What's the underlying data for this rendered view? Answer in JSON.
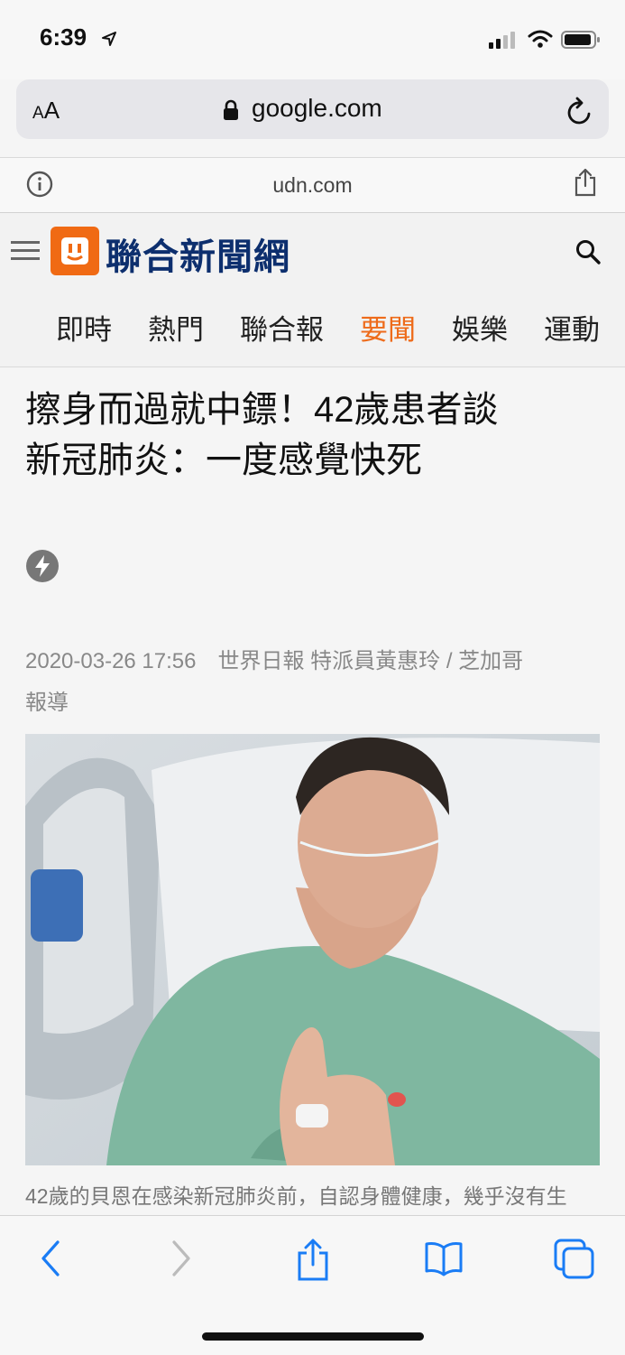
{
  "status_bar": {
    "time": "6:39"
  },
  "address_bar": {
    "text_size_small": "A",
    "text_size_large": "A",
    "url": "google.com"
  },
  "site_bar": {
    "domain": "udn.com"
  },
  "header": {
    "site_name": "聯合新聞網",
    "nav": [
      "即時",
      "熱門",
      "聯合報",
      "要聞",
      "娛樂",
      "運動"
    ],
    "active_nav": "要聞"
  },
  "article": {
    "headline_line1": "擦身而過就中鏢！42歲患者談",
    "headline_line2": "新冠肺炎：一度感覺快死",
    "meta_line1": "2020-03-26 17:56　世界日報 特派員黃惠玲 / 芝加哥",
    "meta_line2": "報導",
    "caption": "42歲的貝恩在感染新冠肺炎前，自認身體健康，幾乎沒有生"
  },
  "colors": {
    "accent": "#ee6b1a",
    "brand_blue": "#0d2f6e",
    "logo_orange": "#f06a14",
    "toolbar_blue": "#1a7cf5"
  }
}
